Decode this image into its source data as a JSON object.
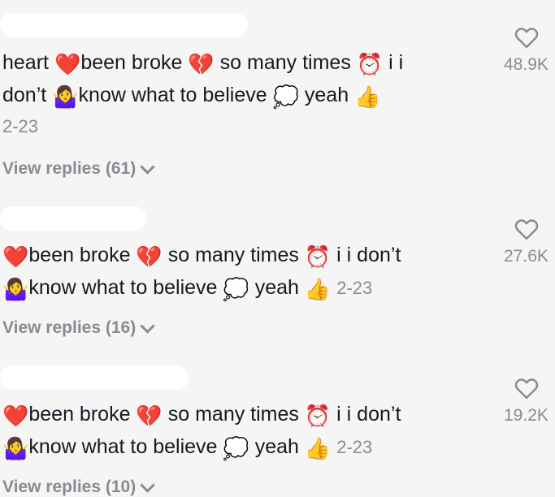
{
  "comments": [
    {
      "line1": [
        "heart ",
        "❤️",
        "been broke ",
        "💔",
        " so many times ",
        "⏰",
        " i i"
      ],
      "line2": [
        "don’t ",
        "🤷‍♀️",
        "know what to believe ",
        "💭",
        " yeah ",
        "👍"
      ],
      "date": "2-23",
      "view_replies": "View replies (61)",
      "likes": "48.9K"
    },
    {
      "line1": [
        "❤️",
        "been broke ",
        "💔",
        " so many times ",
        "⏰",
        " i i don’t"
      ],
      "line2": [
        "🤷‍♀️",
        "know what to believe ",
        "💭",
        " yeah ",
        "👍",
        " "
      ],
      "date": "2-23",
      "view_replies": "View replies (16)",
      "likes": "27.6K"
    },
    {
      "line1": [
        "❤️",
        "been broke ",
        "💔",
        " so many times ",
        "⏰",
        " i i don’t"
      ],
      "line2": [
        "🤷‍♀️",
        "know what to believe ",
        "💭",
        " yeah ",
        "👍",
        " "
      ],
      "date": "2-23",
      "view_replies": "View replies (10)",
      "likes": "19.2K"
    }
  ],
  "icons": {
    "heart_outline": "heart-outline-icon",
    "chevron": "chevron-down-icon"
  },
  "colors": {
    "background": "#f5f5f6",
    "text": "#161823",
    "muted": "#8a8b91"
  }
}
